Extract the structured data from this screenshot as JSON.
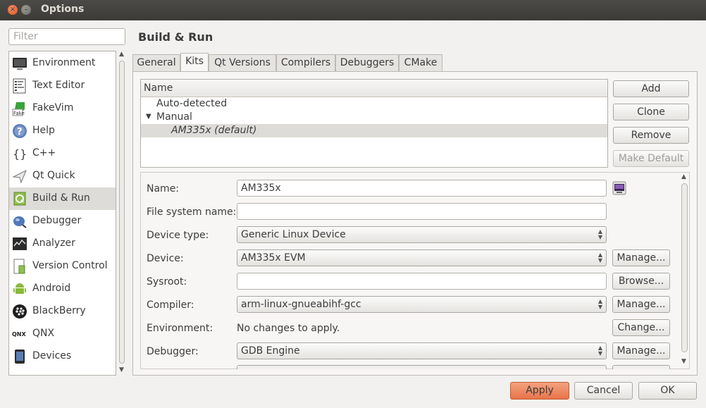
{
  "window": {
    "title": "Options",
    "close_glyph": "×",
    "min_glyph": "–"
  },
  "filter": {
    "placeholder": "Filter",
    "value": ""
  },
  "categories": [
    {
      "label": "Environment",
      "icon": "monitor-icon"
    },
    {
      "label": "Text Editor",
      "icon": "text-editor-icon"
    },
    {
      "label": "FakeVim",
      "icon": "fakevim-icon"
    },
    {
      "label": "Help",
      "icon": "help-icon"
    },
    {
      "label": "C++",
      "icon": "cpp-braces-icon"
    },
    {
      "label": "Qt Quick",
      "icon": "qt-quick-icon"
    },
    {
      "label": "Build & Run",
      "icon": "build-run-icon"
    },
    {
      "label": "Debugger",
      "icon": "debugger-bug-icon"
    },
    {
      "label": "Analyzer",
      "icon": "analyzer-icon"
    },
    {
      "label": "Version Control",
      "icon": "version-control-icon"
    },
    {
      "label": "Android",
      "icon": "android-icon"
    },
    {
      "label": "BlackBerry",
      "icon": "blackberry-icon"
    },
    {
      "label": "QNX",
      "icon": "qnx-icon"
    },
    {
      "label": "Devices",
      "icon": "devices-icon"
    }
  ],
  "selected_category": "Build & Run",
  "page_title": "Build & Run",
  "tabs": [
    {
      "label": "General"
    },
    {
      "label": "Kits"
    },
    {
      "label": "Qt Versions"
    },
    {
      "label": "Compilers"
    },
    {
      "label": "Debuggers"
    },
    {
      "label": "CMake"
    }
  ],
  "active_tab": "Kits",
  "kits": {
    "header": "Name",
    "auto_detected": "Auto-detected",
    "manual": "Manual",
    "selected_kit": "AM335x (default)"
  },
  "kit_buttons": {
    "add": "Add",
    "clone": "Clone",
    "remove": "Remove",
    "make_default": "Make Default"
  },
  "form": {
    "name_label": "Name:",
    "name_value": "AM335x",
    "fsname_label": "File system name:",
    "fsname_value": "",
    "device_type_label": "Device type:",
    "device_type_value": "Generic Linux Device",
    "device_label": "Device:",
    "device_value": "AM335x EVM",
    "device_manage": "Manage...",
    "sysroot_label": "Sysroot:",
    "sysroot_value": "",
    "sysroot_browse": "Browse...",
    "compiler_label": "Compiler:",
    "compiler_value": "arm-linux-gnueabihf-gcc",
    "compiler_manage": "Manage...",
    "environment_label": "Environment:",
    "environment_value": "No changes to apply.",
    "environment_change": "Change...",
    "debugger_label": "Debugger:",
    "debugger_value": "GDB Engine",
    "debugger_manage": "Manage..."
  },
  "footer": {
    "apply": "Apply",
    "cancel": "Cancel",
    "ok": "OK"
  }
}
